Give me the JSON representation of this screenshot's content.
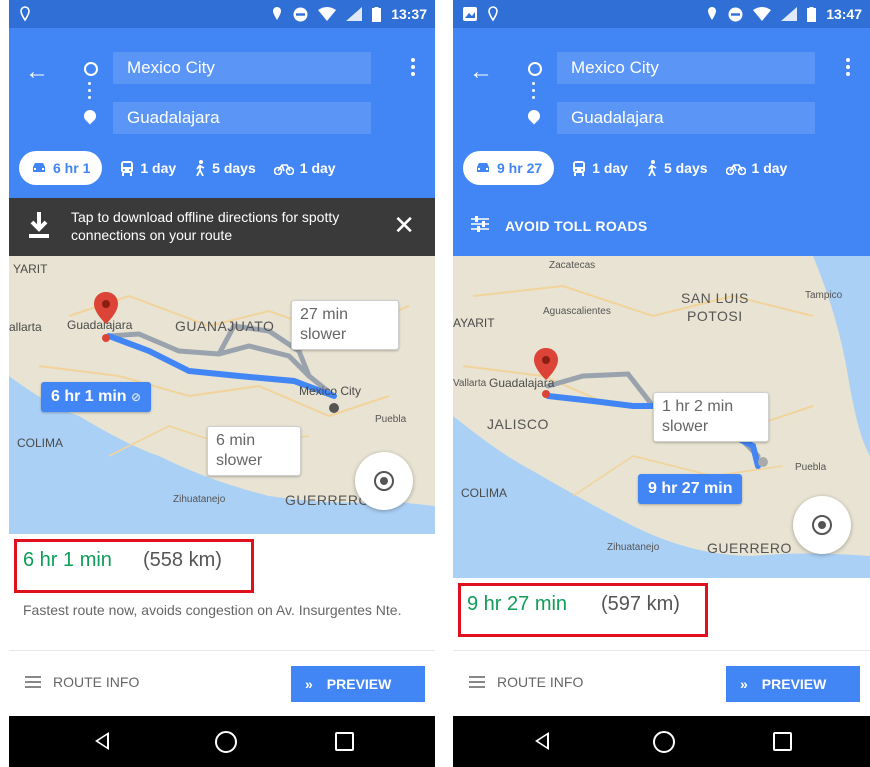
{
  "colors": {
    "header_blue": "#4285f4",
    "status_blue": "#2f6fd6",
    "route_blue": "#4285f4",
    "duration_green": "#0f9d58",
    "highlight_red": "#e0101e"
  },
  "left": {
    "status": {
      "time": "13:37"
    },
    "directions": {
      "from": "Mexico City",
      "to": "Guadalajara"
    },
    "modes": [
      {
        "icon": "car-icon",
        "label": "6 hr 1"
      },
      {
        "icon": "transit-icon",
        "label": "1 day"
      },
      {
        "icon": "walk-icon",
        "label": "5 days"
      },
      {
        "icon": "bike-icon",
        "label": "1 day"
      }
    ],
    "banner": {
      "text": "Tap to download offline directions for spotty connections on your route"
    },
    "map": {
      "labels": [
        "YARIT",
        "allarta",
        "Guadalajara",
        "GUANAJUATO",
        "Mexico City",
        "Puebla",
        "COLIMA",
        "Zihuatanejo",
        "GUERRERO"
      ],
      "bubbles": {
        "primary": "6 hr 1 min",
        "alt1": "27 min slower",
        "alt2": "6 min slower"
      }
    },
    "summary": {
      "duration": "6 hr 1 min",
      "distance": "(558 km)",
      "description": "Fastest route now, avoids congestion on Av. Insurgentes Nte."
    },
    "actions": {
      "route_info": "ROUTE INFO",
      "preview": "PREVIEW"
    }
  },
  "right": {
    "status": {
      "time": "13:47"
    },
    "directions": {
      "from": "Mexico City",
      "to": "Guadalajara"
    },
    "modes": [
      {
        "icon": "car-icon",
        "label": "9 hr 27"
      },
      {
        "icon": "transit-icon",
        "label": "1 day"
      },
      {
        "icon": "walk-icon",
        "label": "5 days"
      },
      {
        "icon": "bike-icon",
        "label": "1 day"
      }
    ],
    "banner": {
      "text": "AVOID TOLL ROADS"
    },
    "map": {
      "labels": [
        "Zacatecas",
        "SAN LUIS",
        "POTOSI",
        "Tampico",
        "Aguascalientes",
        "AYARIT",
        "Vallarta",
        "Guadalajara",
        "JALISCO",
        "Puebla",
        "COLIMA",
        "Zihuatanejo",
        "GUERRERO"
      ],
      "bubbles": {
        "primary": "9 hr 27 min",
        "alt1": "1 hr 2 min slower"
      }
    },
    "summary": {
      "duration": "9 hr 27 min",
      "distance": "(597 km)"
    },
    "actions": {
      "route_info": "ROUTE INFO",
      "preview": "PREVIEW"
    }
  }
}
